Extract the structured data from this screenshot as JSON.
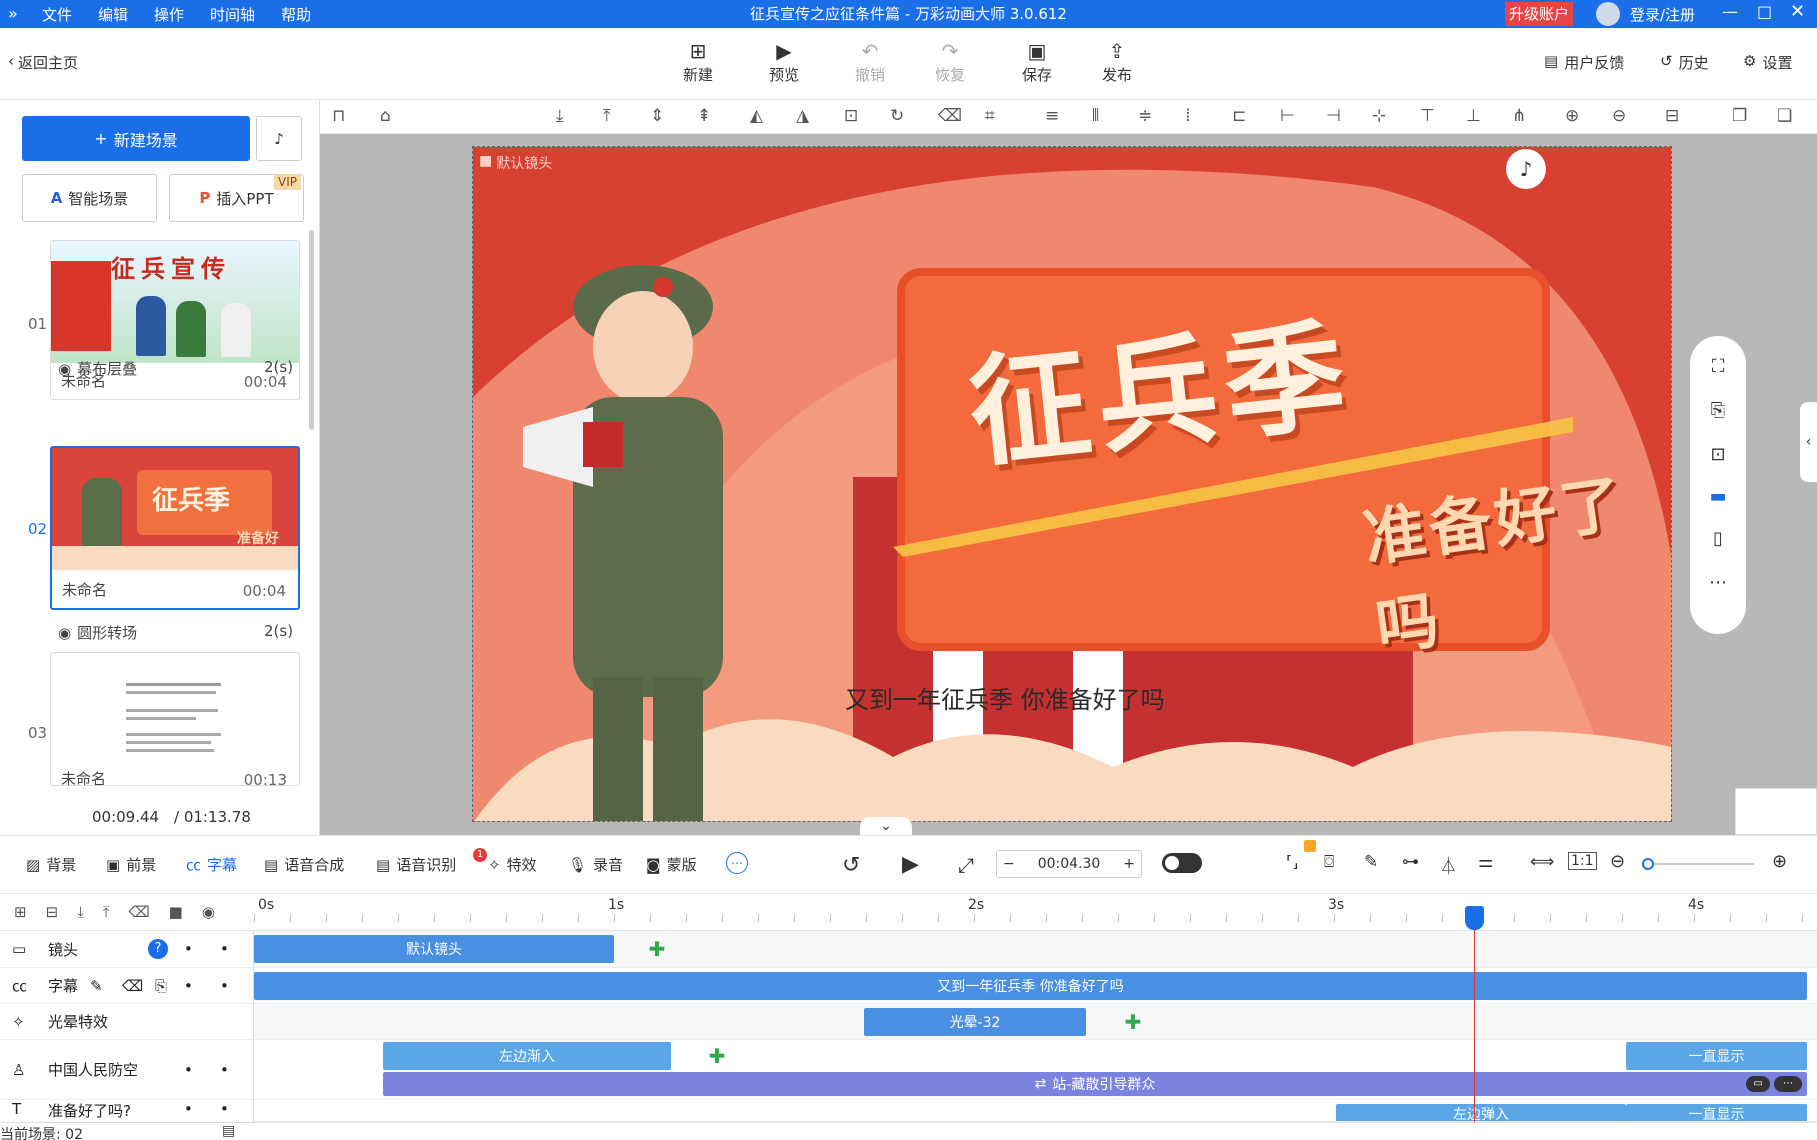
{
  "window": {
    "title": "征兵宣传之应征条件篇 - 万彩动画大师 3.0.612",
    "upgrade": "升级账户",
    "login": "登录/注册"
  },
  "menu": [
    "文件",
    "编辑",
    "操作",
    "时间轴",
    "帮助"
  ],
  "toolbar": {
    "back": "返回主页",
    "buttons": [
      {
        "label": "新建",
        "icon": "new-icon"
      },
      {
        "label": "预览",
        "icon": "play-icon"
      },
      {
        "label": "撤销",
        "icon": "undo-icon"
      },
      {
        "label": "恢复",
        "icon": "redo-icon"
      },
      {
        "label": "保存",
        "icon": "save-icon"
      },
      {
        "label": "发布",
        "icon": "publish-icon"
      }
    ],
    "feedback": "用户反馈",
    "history": "历史",
    "settings": "设置"
  },
  "sidebar": {
    "new_scene": "新建场景",
    "smart_scene": "智能场景",
    "insert_ppt": "插入PPT",
    "vip": "VIP",
    "scenes": [
      {
        "num": "01",
        "name": "未命名",
        "time": "00:04",
        "transition": "幕布层叠",
        "trans_dur": "2(s)",
        "thumb_text": "征兵宣传"
      },
      {
        "num": "02",
        "name": "未命名",
        "time": "00:04",
        "transition": "圆形转场",
        "trans_dur": "2(s)",
        "thumb_text": "征兵季",
        "thumb_sub": "准备好"
      },
      {
        "num": "03",
        "name": "未命名",
        "time": "00:13"
      }
    ],
    "current_time": "00:09.44",
    "total_time": "/ 01:13.78"
  },
  "canvas": {
    "camera_label": "默认镜头",
    "headline": "征兵季",
    "tagline": "准备好了吗",
    "subtitle": "又到一年征兵季 你准备好了吗"
  },
  "bottom_tabs": [
    "背景",
    "前景",
    "字幕",
    "语音合成",
    "语音识别",
    "特效",
    "录音",
    "蒙版"
  ],
  "badge_count": "1",
  "playback": {
    "time": "00:04.30",
    "minus": "−",
    "plus": "+"
  },
  "timeline": {
    "ticks": [
      "0s",
      "1s",
      "2s",
      "3s",
      "4s"
    ],
    "tracks": [
      {
        "label": "镜头"
      },
      {
        "label": "字幕"
      },
      {
        "label": "光晕特效"
      },
      {
        "label": "中国人民防空"
      },
      {
        "label": "准备好了吗?"
      }
    ],
    "clips": {
      "camera": "默认镜头",
      "subtitle": "又到一年征兵季 你准备好了吗",
      "glow": "光晕-32",
      "enter_left": "左边渐入",
      "always_show": "一直显示",
      "guide": "站-藏散引导群众",
      "enter_left2": "左边弹入",
      "always_show2": "一直显示"
    },
    "current_scene": "当前场景: 02"
  }
}
